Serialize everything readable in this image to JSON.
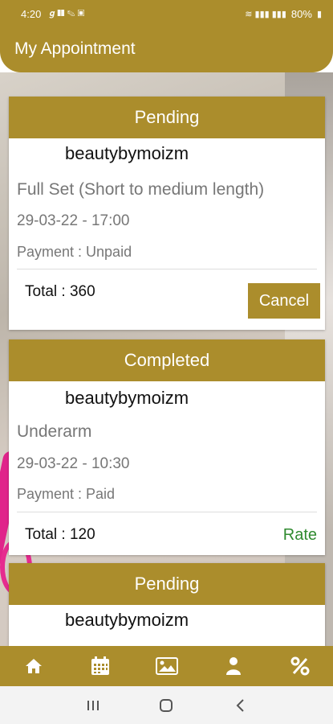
{
  "status_bar": {
    "time": "4:20",
    "battery": "80%"
  },
  "header": {
    "title": "My Appointment"
  },
  "appointments": [
    {
      "status": "Pending",
      "salon": "beautybymoizm",
      "service": "Full Set  (Short to medium length)",
      "datetime": "29-03-22 - 17:00",
      "payment": "Payment : Unpaid",
      "total": "Total : 360",
      "action": "Cancel"
    },
    {
      "status": "Completed",
      "salon": "beautybymoizm",
      "service": "Underarm",
      "datetime": "29-03-22 - 10:30",
      "payment": "Payment : Paid",
      "total": "Total : 120",
      "action": "Rate"
    },
    {
      "status": "Pending",
      "salon": "beautybymoizm"
    }
  ],
  "bottom_nav": {
    "items": [
      "home-icon",
      "calendar-icon",
      "gallery-icon",
      "profile-icon",
      "percent-icon"
    ]
  },
  "colors": {
    "brand": "#ab8d2c",
    "rate": "#2f8a2f"
  }
}
